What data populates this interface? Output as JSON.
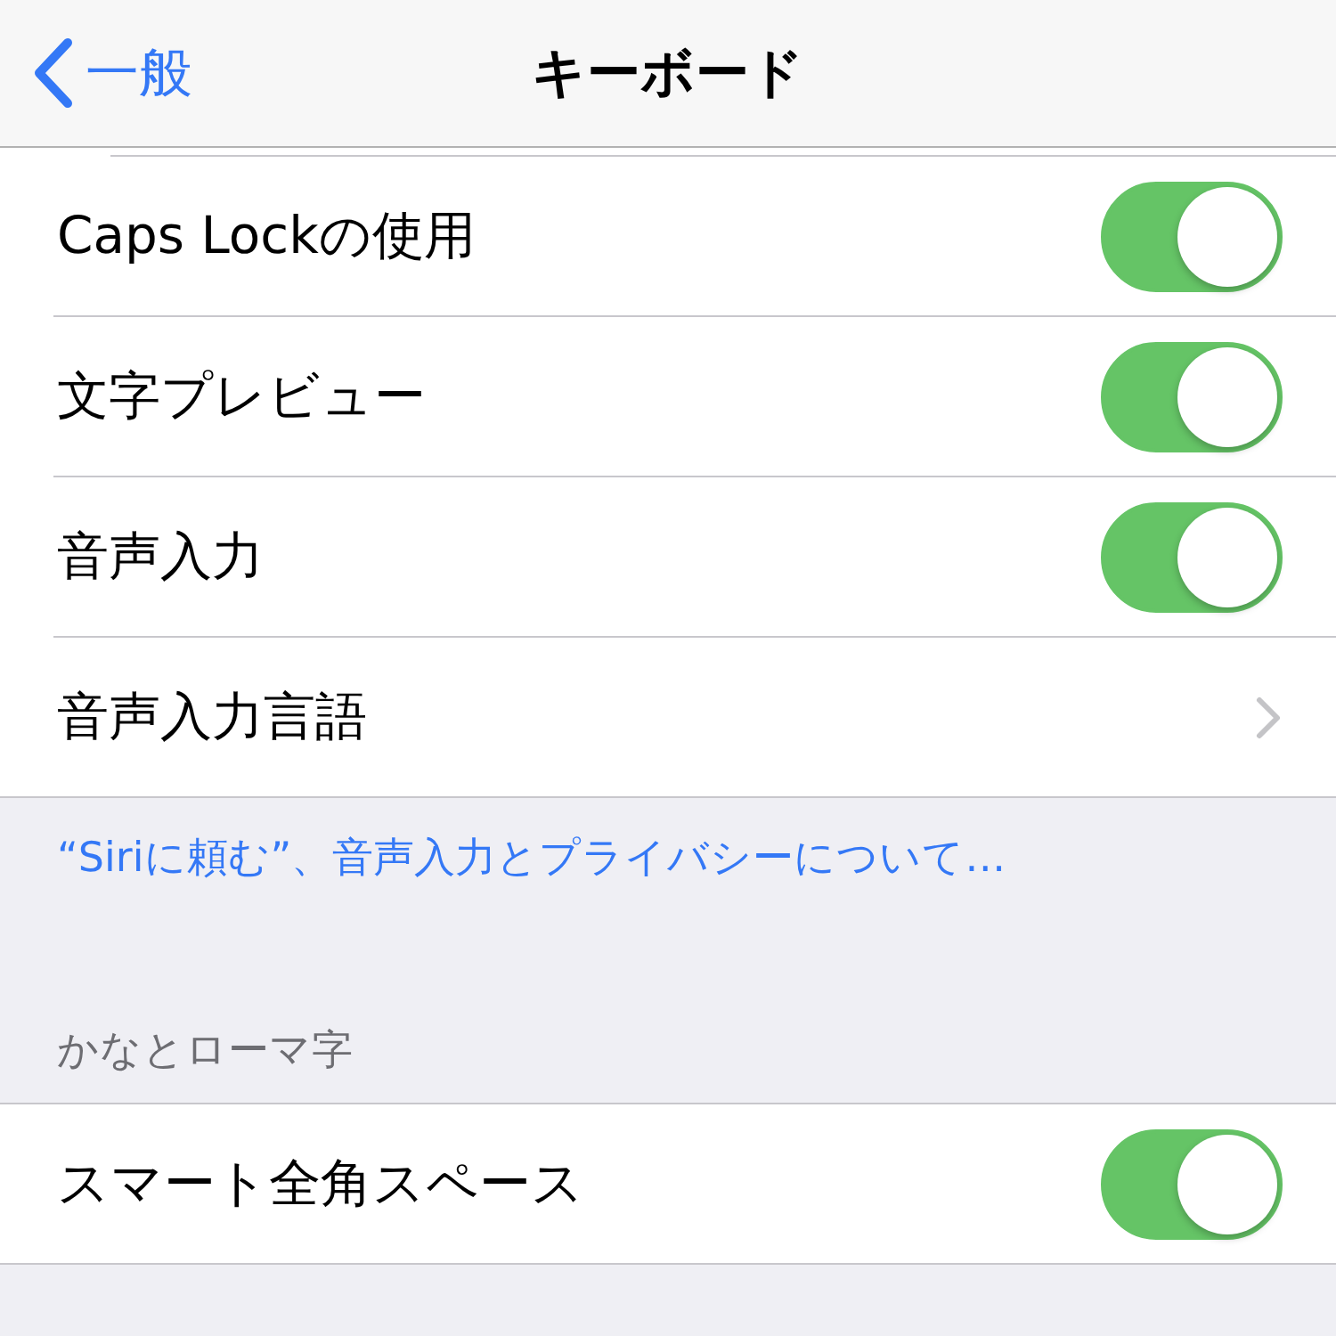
{
  "nav_bar": {
    "back_label": "一般",
    "title": "キーボード"
  },
  "groups": [
    {
      "rows": [
        {
          "kind": "toggle",
          "label": "Caps Lockの使用",
          "on": true
        },
        {
          "kind": "toggle",
          "label": "文字プレビュー",
          "on": true
        },
        {
          "kind": "toggle",
          "label": "音声入力",
          "on": true
        },
        {
          "kind": "link",
          "label": "音声入力言語"
        }
      ],
      "footer_link": "“Siriに頼む”、音声入力とプライバシーについて…"
    },
    {
      "header": "かなとローマ字",
      "rows": [
        {
          "kind": "toggle",
          "label": "スマート全角スペース",
          "on": true
        }
      ]
    }
  ]
}
